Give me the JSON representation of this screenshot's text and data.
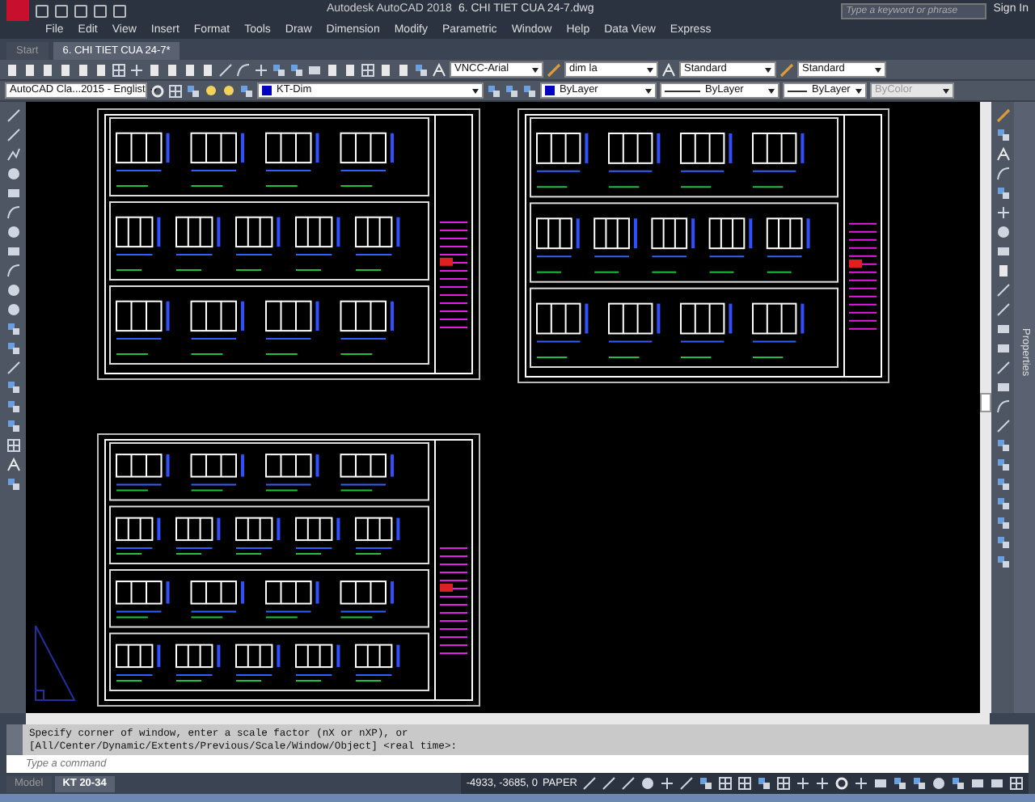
{
  "window": {
    "title": "Autodesk AutoCAD 2018",
    "document": "6. CHI TIET CUA 24-7.dwg"
  },
  "search": {
    "placeholder": "Type a keyword or phrase"
  },
  "account": {
    "label": "Sign In"
  },
  "menu": [
    "File",
    "Edit",
    "View",
    "Insert",
    "Format",
    "Tools",
    "Draw",
    "Dimension",
    "Modify",
    "Parametric",
    "Window",
    "Help",
    "Data View",
    "Express"
  ],
  "file_tabs": [
    {
      "label": "Start",
      "selected": false
    },
    {
      "label": "6. CHI TIET CUA 24-7*",
      "selected": true
    }
  ],
  "style_toolbar": [
    {
      "label": "VNCC-Arial"
    },
    {
      "label": "dim la"
    },
    {
      "label": "Standard"
    },
    {
      "label": "Standard"
    }
  ],
  "properties_toolbar": {
    "workspace": "AutoCAD Cla...2015 - Englist",
    "layer": "KT-Dim",
    "color_setting": "ByLayer",
    "linetype": "ByLayer",
    "lineweight": "ByLayer",
    "plot_style": {
      "label": "ByColor",
      "disabled": true
    }
  },
  "command_history": [
    "Specify corner of window, enter a scale factor (nX or nXP), or",
    "[All/Center/Dynamic/Extents/Previous/Scale/Window/Object] <real time>:"
  ],
  "command_input": {
    "placeholder": "Type a command"
  },
  "layout_tabs": [
    {
      "label": "Model",
      "selected": false
    },
    {
      "label": "KT 20-34",
      "selected": true
    }
  ],
  "status_bar": {
    "coordinates": "-4933, -3685, 0",
    "space": "PAPER"
  },
  "palette": {
    "title": "Properties"
  }
}
